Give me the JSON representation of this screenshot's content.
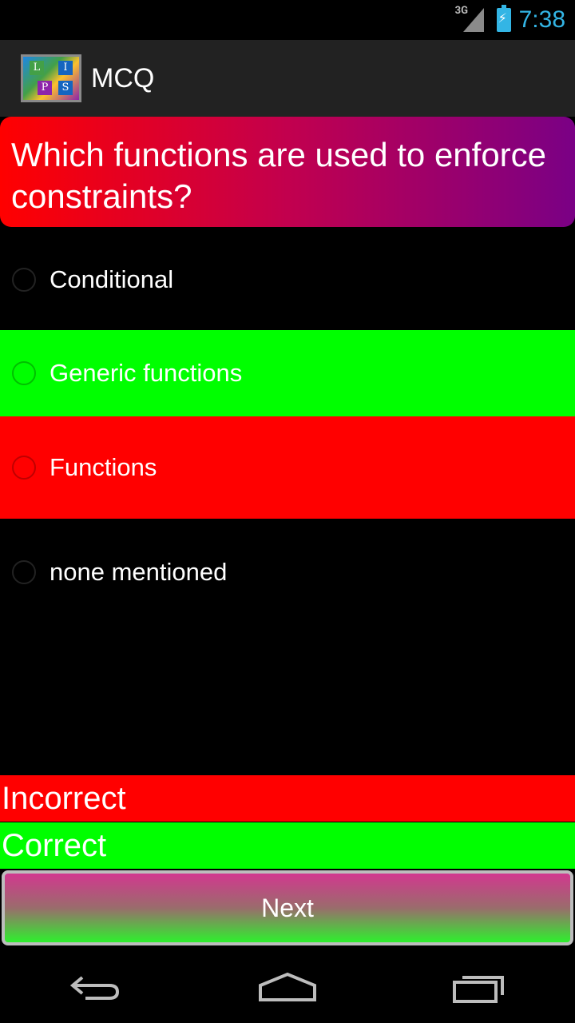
{
  "status_bar": {
    "network": "3G",
    "time": "7:38",
    "accent_color": "#33b5e5"
  },
  "action_bar": {
    "title": "MCQ",
    "logo_letters": [
      "L",
      "I",
      "S",
      "P"
    ]
  },
  "question": {
    "text": "Which functions are used to enforce constraints?"
  },
  "options": [
    {
      "label": "Conditional",
      "state": "unselected",
      "background": "#000000"
    },
    {
      "label": "Generic functions",
      "state": "correct",
      "background": "#00ff00"
    },
    {
      "label": "Functions",
      "state": "incorrect",
      "background": "#ff0000"
    },
    {
      "label": "none mentioned",
      "state": "unselected",
      "background": "#000000"
    }
  ],
  "results": {
    "incorrect_label": "Incorrect",
    "incorrect_color": "#ff0000",
    "correct_label": "Correct",
    "correct_color": "#00ff00"
  },
  "next_button": {
    "label": "Next"
  },
  "nav_bar": {
    "icons": [
      "back-icon",
      "home-icon",
      "recent-apps-icon"
    ]
  }
}
